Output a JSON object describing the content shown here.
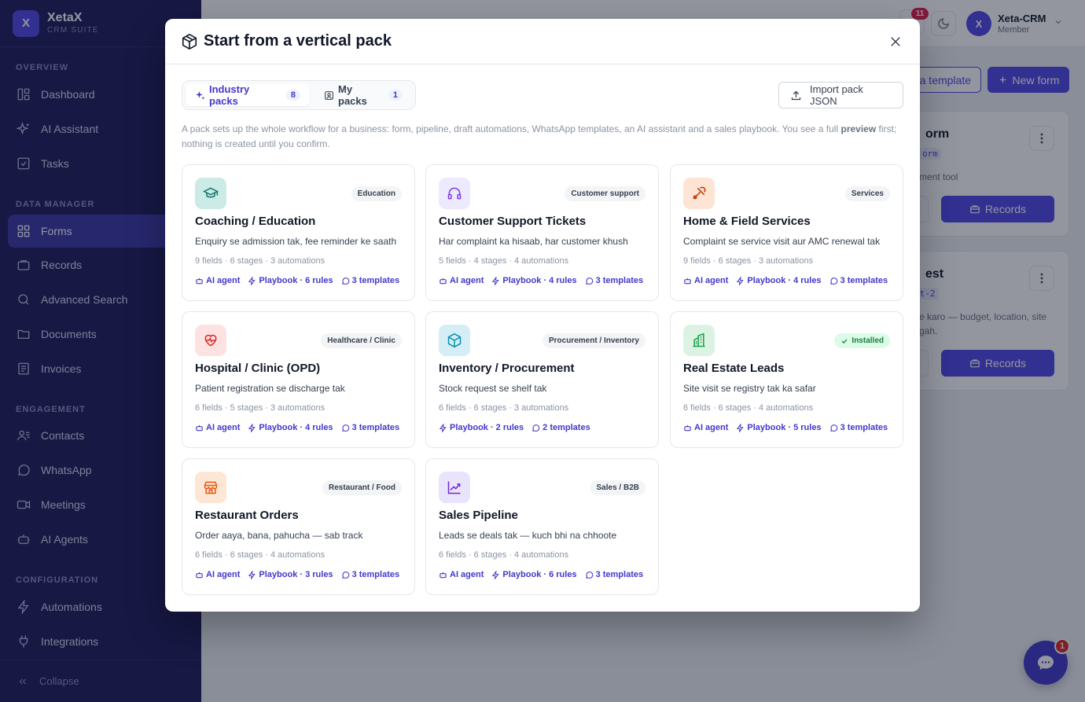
{
  "app": {
    "brand_name": "XetaX",
    "brand_sub": "CRM SUITE",
    "brand_initial": "X"
  },
  "sidebar": {
    "sections": [
      {
        "label": "OVERVIEW"
      },
      {
        "label": "DATA MANAGER"
      },
      {
        "label": "ENGAGEMENT"
      },
      {
        "label": "CONFIGURATION"
      }
    ],
    "items": [
      {
        "label": "Dashboard",
        "icon": "dashboard-icon"
      },
      {
        "label": "AI Assistant",
        "icon": "sparkle-icon"
      },
      {
        "label": "Tasks",
        "icon": "task-check-icon"
      },
      {
        "label": "Forms",
        "icon": "forms-grid-icon",
        "active": true
      },
      {
        "label": "Records",
        "icon": "records-icon"
      },
      {
        "label": "Advanced Search",
        "icon": "search-icon"
      },
      {
        "label": "Documents",
        "icon": "folder-icon"
      },
      {
        "label": "Invoices",
        "icon": "invoice-icon"
      },
      {
        "label": "Contacts",
        "icon": "contacts-icon"
      },
      {
        "label": "WhatsApp",
        "icon": "whatsapp-icon"
      },
      {
        "label": "Meetings",
        "icon": "video-icon"
      },
      {
        "label": "AI Agents",
        "icon": "robot-icon"
      },
      {
        "label": "Automations",
        "icon": "bolt-icon"
      },
      {
        "label": "Integrations",
        "icon": "plug-icon"
      }
    ],
    "collapse_label": "Collapse"
  },
  "header": {
    "notif_count": "11",
    "user_initial": "X",
    "user_name": "Xeta-CRM",
    "user_role": "Member"
  },
  "background": {
    "template_btn": "a template",
    "new_form_btn": "New form",
    "cards": [
      {
        "title": "orm",
        "slug": "orm",
        "desc": "ment tool",
        "records_label": "Records"
      },
      {
        "title": "est",
        "slug": "st-2",
        "desc": "e karo — budget, location, site gah.",
        "records_label": "Records"
      }
    ]
  },
  "chat": {
    "badge": "1"
  },
  "modal": {
    "title": "Start from a vertical pack",
    "tabs": [
      {
        "label": "Industry packs",
        "count": "8",
        "active": true
      },
      {
        "label": "My packs",
        "count": "1",
        "active": false
      }
    ],
    "import_label": "Import pack JSON",
    "desc_before": "A pack sets up the whole workflow for a business: form, pipeline, draft automations, WhatsApp templates, an AI assistant and a sales playbook. You see a full ",
    "desc_bold": "preview",
    "desc_after": " first; nothing is created until you confirm."
  },
  "packs": [
    {
      "title": "Coaching / Education",
      "tag": "Education",
      "subtitle": "Enquiry se admission tak, fee reminder ke saath",
      "meta": "9 fields · 6 stages · 3 automations",
      "ai_agent": "AI agent",
      "playbook": "Playbook · 6 rules",
      "templates": "3 templates",
      "icon": "graduation-cap-icon",
      "color": "#0f766e",
      "bg": "#ccebe6"
    },
    {
      "title": "Customer Support Tickets",
      "tag": "Customer support",
      "subtitle": "Har complaint ka hisaab, har customer khush",
      "meta": "5 fields · 4 stages · 4 automations",
      "ai_agent": "AI agent",
      "playbook": "Playbook · 4 rules",
      "templates": "3 templates",
      "icon": "headphones-icon",
      "color": "#7c3aed",
      "bg": "#ede9fe"
    },
    {
      "title": "Home & Field Services",
      "tag": "Services",
      "subtitle": "Complaint se service visit aur AMC renewal tak",
      "meta": "9 fields · 6 stages · 3 automations",
      "ai_agent": "AI agent",
      "playbook": "Playbook · 4 rules",
      "templates": "3 templates",
      "icon": "tools-icon",
      "color": "#c2410c",
      "bg": "#fde4d4"
    },
    {
      "title": "Hospital / Clinic (OPD)",
      "tag": "Healthcare / Clinic",
      "subtitle": "Patient registration se discharge tak",
      "meta": "6 fields · 5 stages · 3 automations",
      "ai_agent": "AI agent",
      "playbook": "Playbook · 4 rules",
      "templates": "3 templates",
      "icon": "heart-pulse-icon",
      "color": "#dc2626",
      "bg": "#fde2e2"
    },
    {
      "title": "Inventory / Procurement",
      "tag": "Procurement / Inventory",
      "subtitle": "Stock request se shelf tak",
      "meta": "6 fields · 6 stages · 3 automations",
      "ai_agent": "",
      "playbook": "Playbook · 2 rules",
      "templates": "2 templates",
      "icon": "package-box-icon",
      "color": "#0891b2",
      "bg": "#d5eef5"
    },
    {
      "title": "Real Estate Leads",
      "tag": "Installed",
      "installed": true,
      "subtitle": "Site visit se registry tak ka safar",
      "meta": "6 fields · 6 stages · 4 automations",
      "ai_agent": "AI agent",
      "playbook": "Playbook · 5 rules",
      "templates": "3 templates",
      "icon": "building-icon",
      "color": "#16a34a",
      "bg": "#dcf3e3"
    },
    {
      "title": "Restaurant Orders",
      "tag": "Restaurant / Food",
      "subtitle": "Order aaya, bana, pahucha — sab track",
      "meta": "6 fields · 6 stages · 4 automations",
      "ai_agent": "AI agent",
      "playbook": "Playbook · 3 rules",
      "templates": "3 templates",
      "icon": "storefront-icon",
      "color": "#ea580c",
      "bg": "#fde6d6"
    },
    {
      "title": "Sales Pipeline",
      "tag": "Sales / B2B",
      "subtitle": "Leads se deals tak — kuch bhi na chhoote",
      "meta": "6 fields · 6 stages · 4 automations",
      "ai_agent": "AI agent",
      "playbook": "Playbook · 6 rules",
      "templates": "3 templates",
      "icon": "trend-up-icon",
      "color": "#6d28d9",
      "bg": "#e9e4fb"
    }
  ]
}
